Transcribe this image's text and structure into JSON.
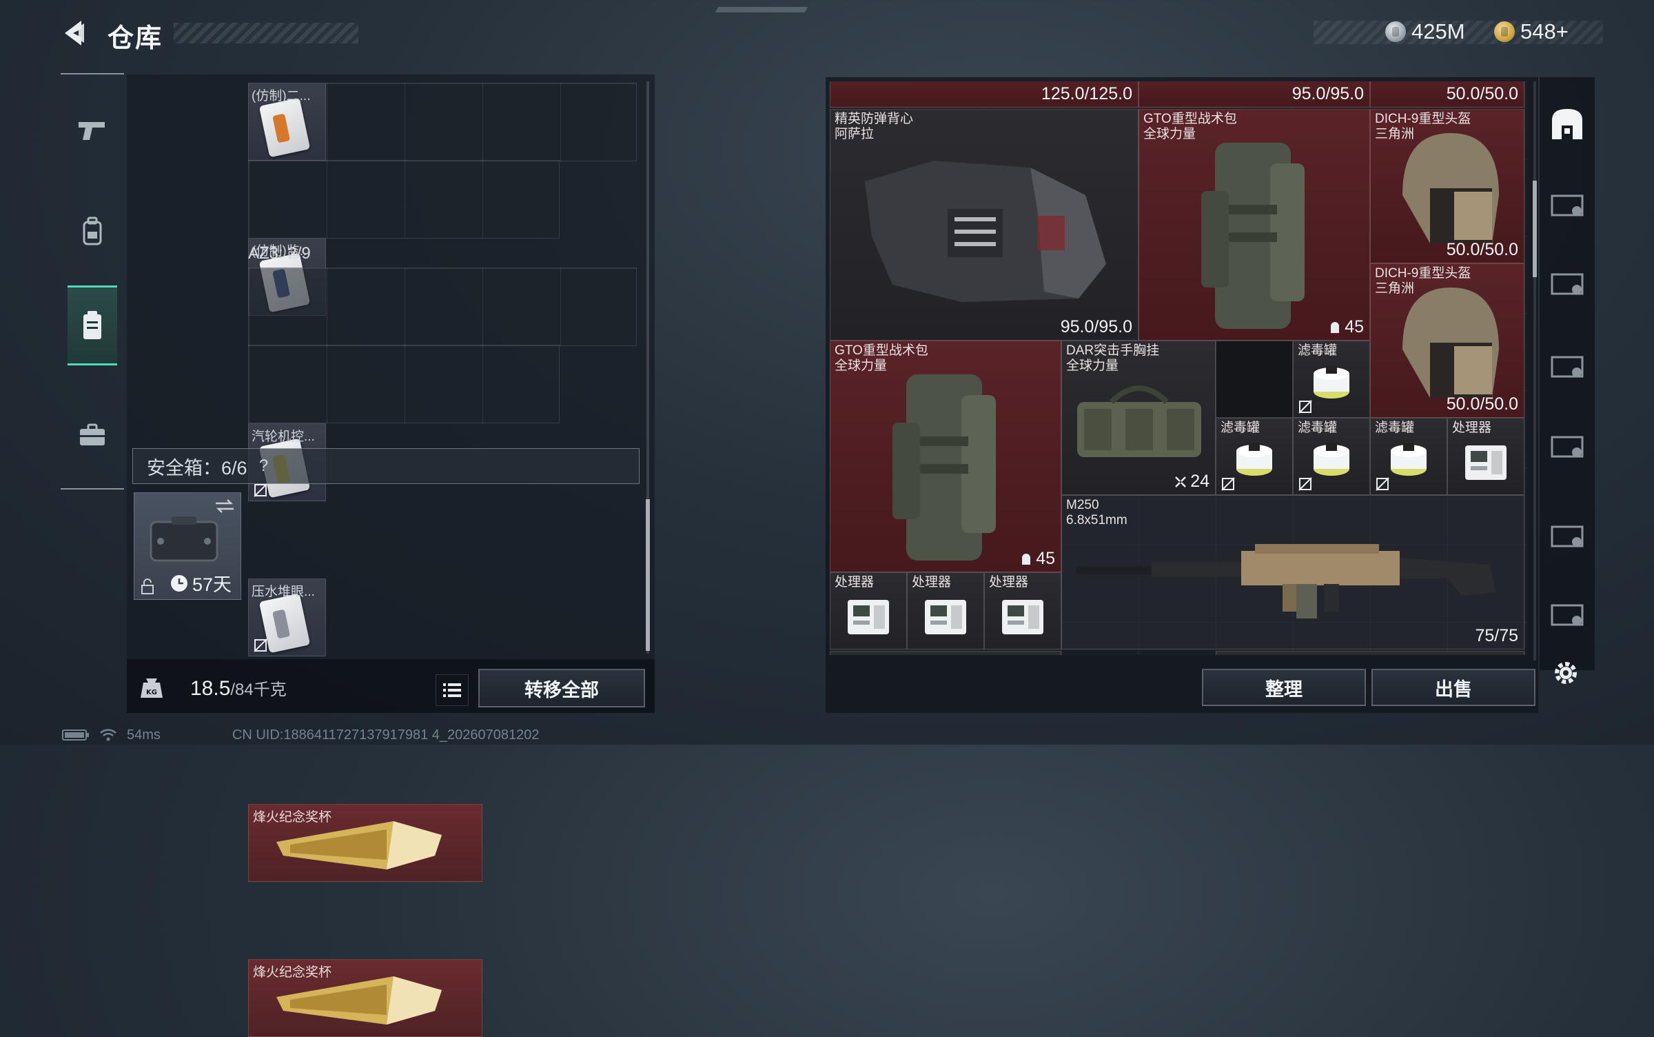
{
  "header": {
    "title": "仓库",
    "currencies": [
      {
        "icon": "silver-coin-icon",
        "value": "425M"
      },
      {
        "icon": "gold-coin-icon",
        "value": "548+"
      }
    ]
  },
  "left_tabs": [
    {
      "name": "weapons",
      "icon": "pistol-icon"
    },
    {
      "name": "equipment",
      "icon": "backpack-icon"
    },
    {
      "name": "containers",
      "icon": "container-icon",
      "active": true
    },
    {
      "name": "supplies",
      "icon": "briefcase-icon"
    }
  ],
  "storage": {
    "top_items": [
      {
        "name": "(仿制)二..."
      },
      {
        "name": "(仿制)监..."
      }
    ],
    "az3_label": "AZ3: 2/9",
    "az3_items": [
      {
        "name": "汽轮机控..."
      },
      {
        "name": "压水堆眼..."
      }
    ],
    "safebox_label": "安全箱：6/6",
    "safebox_help": "?",
    "safebox_timer": "57天",
    "safebox_items": [
      {
        "name": "烽火纪念奖杯"
      },
      {
        "name": "烽火纪念奖杯"
      }
    ]
  },
  "weight": {
    "current": "18.5",
    "max": "/84千克"
  },
  "buttons": {
    "transfer_all": "转移全部",
    "sort": "整理",
    "sell": "出售"
  },
  "status": {
    "ping": "54ms",
    "uid": "CN UID:1886411727137917981 4_202607081202"
  },
  "inventory": {
    "top_row_durability": [
      "125.0/125.0",
      "95.0/95.0",
      "50.0/50.0"
    ],
    "items": [
      {
        "id": "vest",
        "name": "精英防弹背心\n阿萨拉",
        "durability": "95.0/95.0"
      },
      {
        "id": "bag1",
        "name": "GTO重型战术包\n全球力量",
        "capacity": "45"
      },
      {
        "id": "helmet1",
        "name": "DICH-9重型头盔\n三角洲",
        "durability": "50.0/50.0"
      },
      {
        "id": "helmet2",
        "name": "DICH-9重型头盔\n三角洲",
        "durability": "50.0/50.0"
      },
      {
        "id": "bag2",
        "name": "GTO重型战术包\n全球力量",
        "capacity": "45"
      },
      {
        "id": "rig",
        "name": "DAR突击手胸挂\n全球力量",
        "capacity": "24"
      },
      {
        "id": "canister1",
        "name": "滤毒罐"
      },
      {
        "id": "canister2",
        "name": "滤毒罐"
      },
      {
        "id": "canister3",
        "name": "滤毒罐"
      },
      {
        "id": "canister4",
        "name": "滤毒罐"
      },
      {
        "id": "processor1",
        "name": "处理器"
      },
      {
        "id": "gun",
        "name": "M250\n6.8x51mm",
        "ammo": "75/75"
      },
      {
        "id": "processor2",
        "name": "处理器"
      },
      {
        "id": "processor3",
        "name": "处理器"
      },
      {
        "id": "processor4",
        "name": "处理器"
      }
    ]
  },
  "colors": {
    "accent": "#52d7b9",
    "item_red": "#5a2328",
    "panel": "#1b232c"
  }
}
